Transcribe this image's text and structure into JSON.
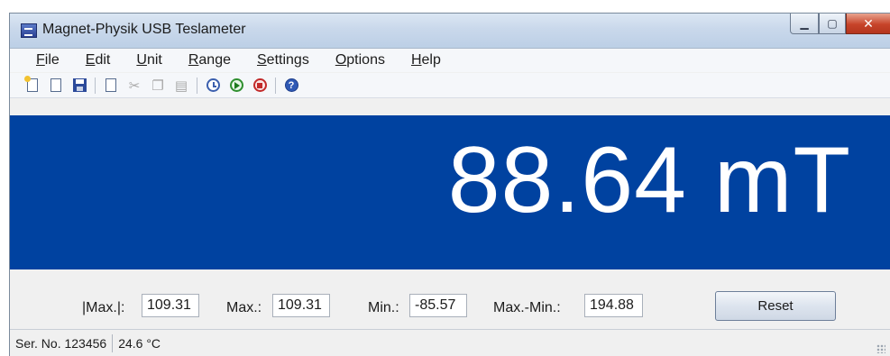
{
  "window": {
    "title": "Magnet-Physik USB Teslameter"
  },
  "menu": [
    {
      "accel": "F",
      "rest": "ile"
    },
    {
      "accel": "E",
      "rest": "dit"
    },
    {
      "accel": "U",
      "rest": "nit"
    },
    {
      "accel": "R",
      "rest": "ange"
    },
    {
      "accel": "S",
      "rest": "ettings"
    },
    {
      "accel": "O",
      "rest": "ptions"
    },
    {
      "accel": "H",
      "rest": "elp"
    }
  ],
  "toolbar": {
    "icons": [
      "new-icon",
      "open-icon",
      "save-icon",
      "page-icon",
      "cut-icon",
      "copy-icon",
      "paste-icon",
      "clock-icon",
      "play-icon",
      "stop-icon",
      "help-icon"
    ],
    "help_glyph": "?"
  },
  "display": {
    "reading": "88.64 mT",
    "background": "#0042a0"
  },
  "stats": {
    "abs_max_label": "|Max.|:",
    "abs_max_value": "109.31",
    "max_label": "Max.:",
    "max_value": "109.31",
    "min_label": "Min.:",
    "min_value": "-85.57",
    "range_label": "Max.-Min.:",
    "range_value": "194.88",
    "reset_label": "Reset"
  },
  "status": {
    "serial": "Ser. No. 123456",
    "temperature": "24.6 °C"
  }
}
